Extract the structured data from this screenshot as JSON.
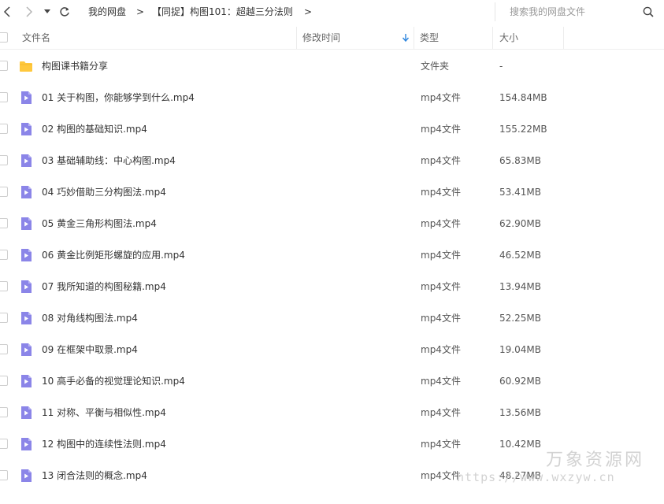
{
  "toolbar": {
    "breadcrumbs": [
      "我的网盘",
      "【同捉】构图101：超越三分法则"
    ],
    "search_placeholder": "搜索我的网盘文件"
  },
  "header": {
    "name": "文件名",
    "modified": "修改时间",
    "type": "类型",
    "size": "大小"
  },
  "colors": {
    "folder": "#ffc83d",
    "video": "#8b85e8",
    "sort_arrow": "#2e86de"
  },
  "rows": [
    {
      "name": "构图课书籍分享",
      "type": "文件夹",
      "size": "-",
      "icon": "folder-icon"
    },
    {
      "name": "01 关于构图，你能够学到什么.mp4",
      "type": "mp4文件",
      "size": "154.84MB",
      "icon": "video-file-icon"
    },
    {
      "name": "02 构图的基础知识.mp4",
      "type": "mp4文件",
      "size": "155.22MB",
      "icon": "video-file-icon"
    },
    {
      "name": "03 基础辅助线：中心构图.mp4",
      "type": "mp4文件",
      "size": "65.83MB",
      "icon": "video-file-icon"
    },
    {
      "name": "04 巧妙借助三分构图法.mp4",
      "type": "mp4文件",
      "size": "53.41MB",
      "icon": "video-file-icon"
    },
    {
      "name": "05 黄金三角形构图法.mp4",
      "type": "mp4文件",
      "size": "62.90MB",
      "icon": "video-file-icon"
    },
    {
      "name": "06 黄金比例矩形螺旋的应用.mp4",
      "type": "mp4文件",
      "size": "46.52MB",
      "icon": "video-file-icon"
    },
    {
      "name": "07 我所知道的构图秘籍.mp4",
      "type": "mp4文件",
      "size": "13.94MB",
      "icon": "video-file-icon"
    },
    {
      "name": "08 对角线构图法.mp4",
      "type": "mp4文件",
      "size": "52.25MB",
      "icon": "video-file-icon"
    },
    {
      "name": "09 在框架中取景.mp4",
      "type": "mp4文件",
      "size": "19.04MB",
      "icon": "video-file-icon"
    },
    {
      "name": "10 高手必备的视觉理论知识.mp4",
      "type": "mp4文件",
      "size": "60.92MB",
      "icon": "video-file-icon"
    },
    {
      "name": "11 对称、平衡与相似性.mp4",
      "type": "mp4文件",
      "size": "13.56MB",
      "icon": "video-file-icon"
    },
    {
      "name": "12 构图中的连续性法则.mp4",
      "type": "mp4文件",
      "size": "10.42MB",
      "icon": "video-file-icon"
    },
    {
      "name": "13 闭合法则的概念.mp4",
      "type": "mp4文件",
      "size": "48.27MB",
      "icon": "video-file-icon"
    }
  ],
  "watermark": {
    "title": "万象资源网",
    "url": "https://www.wxzyw.cn"
  }
}
